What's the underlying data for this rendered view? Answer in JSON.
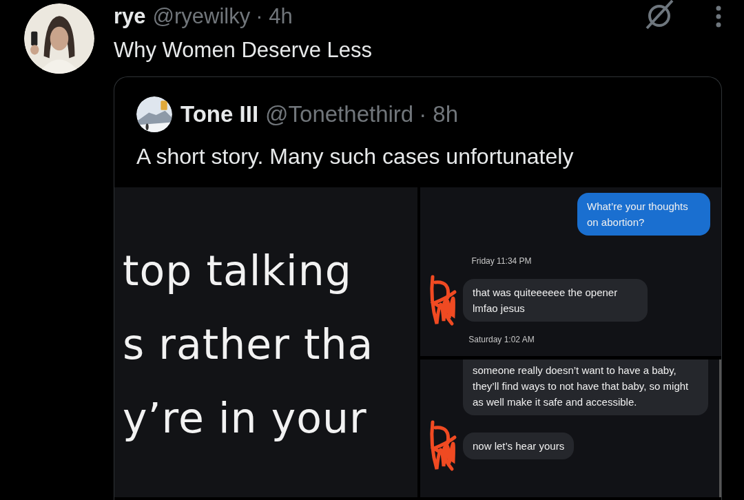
{
  "post": {
    "author": {
      "name": "rye",
      "handle": "@ryewilky",
      "time": "· 4h"
    },
    "text": "Why Women Deserve Less",
    "quote": {
      "author": {
        "name": "Tone III",
        "handle": "@Tonethethird",
        "time": "· 8h"
      },
      "text": "A short story. Many such cases unfortunately",
      "media": [
        {
          "kind": "caption",
          "lines": [
            "top talking",
            "s rather tha",
            "y’re in your"
          ]
        },
        {
          "kind": "chat",
          "messages": [
            {
              "kind": "sent",
              "text": "What’re your thoughts on abortion?"
            },
            {
              "kind": "timestamp",
              "text": "Friday 11:34 PM"
            },
            {
              "kind": "received",
              "scribbled": true,
              "text": "that was quiteeeeee the opener lmfao jesus"
            },
            {
              "kind": "timestamp",
              "text": "Saturday 1:02 AM"
            }
          ]
        },
        {
          "kind": "chat",
          "messages": [
            {
              "kind": "received",
              "scribbled": false,
              "cut": true,
              "text": "someone really doesn’t want to have a baby, they’ll find ways to not have that baby, so might as well make it safe and accessible."
            },
            {
              "kind": "received",
              "scribbled": true,
              "text": "now let’s hear yours"
            }
          ]
        }
      ]
    }
  }
}
